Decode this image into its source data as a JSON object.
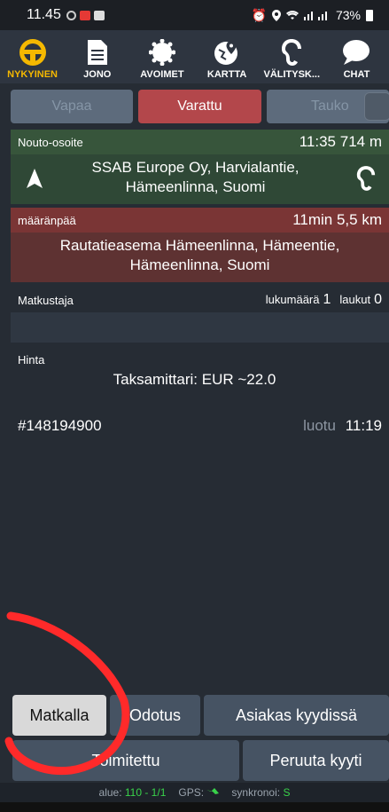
{
  "status_bar": {
    "time": "11.45",
    "battery": "73%"
  },
  "nav": [
    {
      "label": "NYKYINEN",
      "icon": "steering-wheel-icon"
    },
    {
      "label": "JONO",
      "icon": "document-icon"
    },
    {
      "label": "AVOIMET",
      "icon": "starburst-icon"
    },
    {
      "label": "KARTTA",
      "icon": "map-pin-icon"
    },
    {
      "label": "VÄLITYSK...",
      "icon": "ear-icon"
    },
    {
      "label": "CHAT",
      "icon": "chat-bubble-icon"
    }
  ],
  "state_toggle": {
    "free": "Vapaa",
    "busy": "Varattu",
    "break": "Tauko"
  },
  "pickup": {
    "label": "Nouto-osoite",
    "eta": "11:35 714 m",
    "address_line1": "SSAB Europe Oy, Harvialantie,",
    "address_line2": "Hämeenlinna, Suomi"
  },
  "destination": {
    "label": "määränpää",
    "eta": "11min 5,5 km",
    "address_line1": "Rautatieasema Hämeenlinna, Hämeentie,",
    "address_line2": "Hämeenlinna, Suomi"
  },
  "passenger": {
    "label": "Matkustaja",
    "count_label": "lukumäärä",
    "count": "1",
    "bags_label": "laukut",
    "bags": "0"
  },
  "price": {
    "label": "Hinta",
    "value": "Taksamittari: EUR ~22.0"
  },
  "order": {
    "id": "#148194900",
    "created_label": "luotu",
    "created_time": "11:19"
  },
  "buttons": {
    "en_route": "Matkalla",
    "waiting": "Odotus",
    "customer_onboard": "Asiakas kyydissä",
    "delivered": "Toimitettu",
    "cancel_ride": "Peruuta kyyti"
  },
  "footer": {
    "area_label": "alue:",
    "area_value": "110 - 1/1",
    "gps_label": "GPS:",
    "sync_label": "synkronoi:",
    "sync_value": "S"
  },
  "colors": {
    "accent": "#f5b800",
    "busy": "#b3474b",
    "pickup": "#37553b",
    "destination": "#7a3535"
  }
}
